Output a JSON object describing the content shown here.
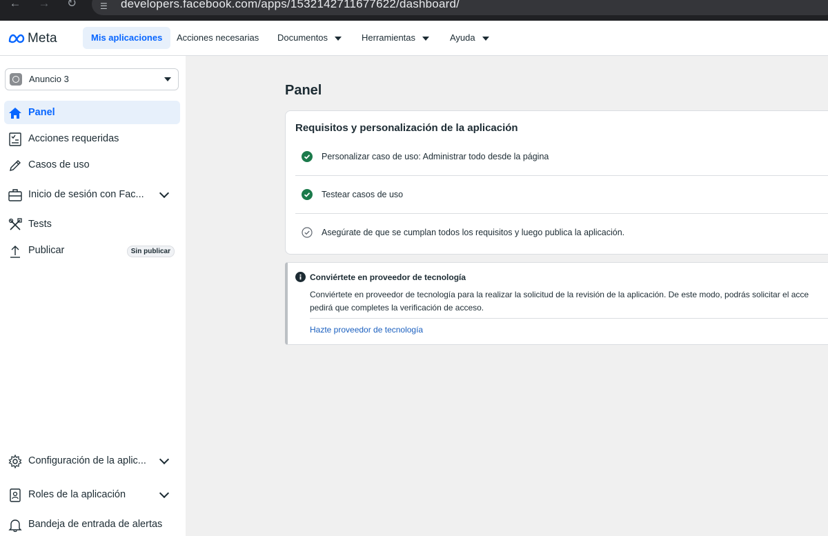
{
  "browser": {
    "url": "developers.facebook.com/apps/1532142711677622/dashboard/"
  },
  "topnav": {
    "logo": "Meta",
    "items": [
      {
        "label": "Mis aplicaciones",
        "active": true
      },
      {
        "label": "Acciones necesarias"
      },
      {
        "label": "Documentos"
      },
      {
        "label": "Herramientas"
      },
      {
        "label": "Ayuda"
      }
    ]
  },
  "sidebar": {
    "app_selector": "Anuncio 3",
    "items": [
      {
        "label": "Panel",
        "icon": "home-icon",
        "active": true
      },
      {
        "label": "Acciones requeridas",
        "icon": "checklist-icon"
      },
      {
        "label": "Casos de uso",
        "icon": "pencil-icon"
      },
      {
        "label": "Inicio de sesión con Fac...",
        "icon": "briefcase-icon"
      },
      {
        "label": "Tests",
        "icon": "tools-icon"
      },
      {
        "label": "Publicar",
        "icon": "upload-icon",
        "badge": "Sin publicar"
      }
    ],
    "bottom_items": [
      {
        "label": "Configuración de la aplic...",
        "icon": "gear-icon"
      },
      {
        "label": "Roles de la aplicación",
        "icon": "user-badge-icon"
      },
      {
        "label": "Bandeja de entrada de alertas",
        "icon": "bell-icon"
      }
    ]
  },
  "main": {
    "title": "Panel",
    "requirements": {
      "title": "Requisitos y personalización de la aplicación",
      "items": [
        {
          "label": "Personalizar caso de uso: Administrar todo desde la página",
          "status": "done"
        },
        {
          "label": "Testear casos de uso",
          "status": "done"
        },
        {
          "label": "Asegúrate de que se cumplan todos los requisitos y luego publica la aplicación.",
          "status": "pending"
        }
      ]
    },
    "notice": {
      "title": "Conviértete en proveedor de tecnología",
      "body_line1": "Conviértete en proveedor de tecnología para la realizar la solicitud de la revisión de la aplicación. De este modo, podrás solicitar el acce",
      "body_line2": "pedirá que completes la verificación de acceso.",
      "link": "Hazte proveedor de tecnología"
    }
  },
  "colors": {
    "accent": "#0866ff",
    "success": "#1b7a4b",
    "page_bg": "#f0f0f0"
  }
}
